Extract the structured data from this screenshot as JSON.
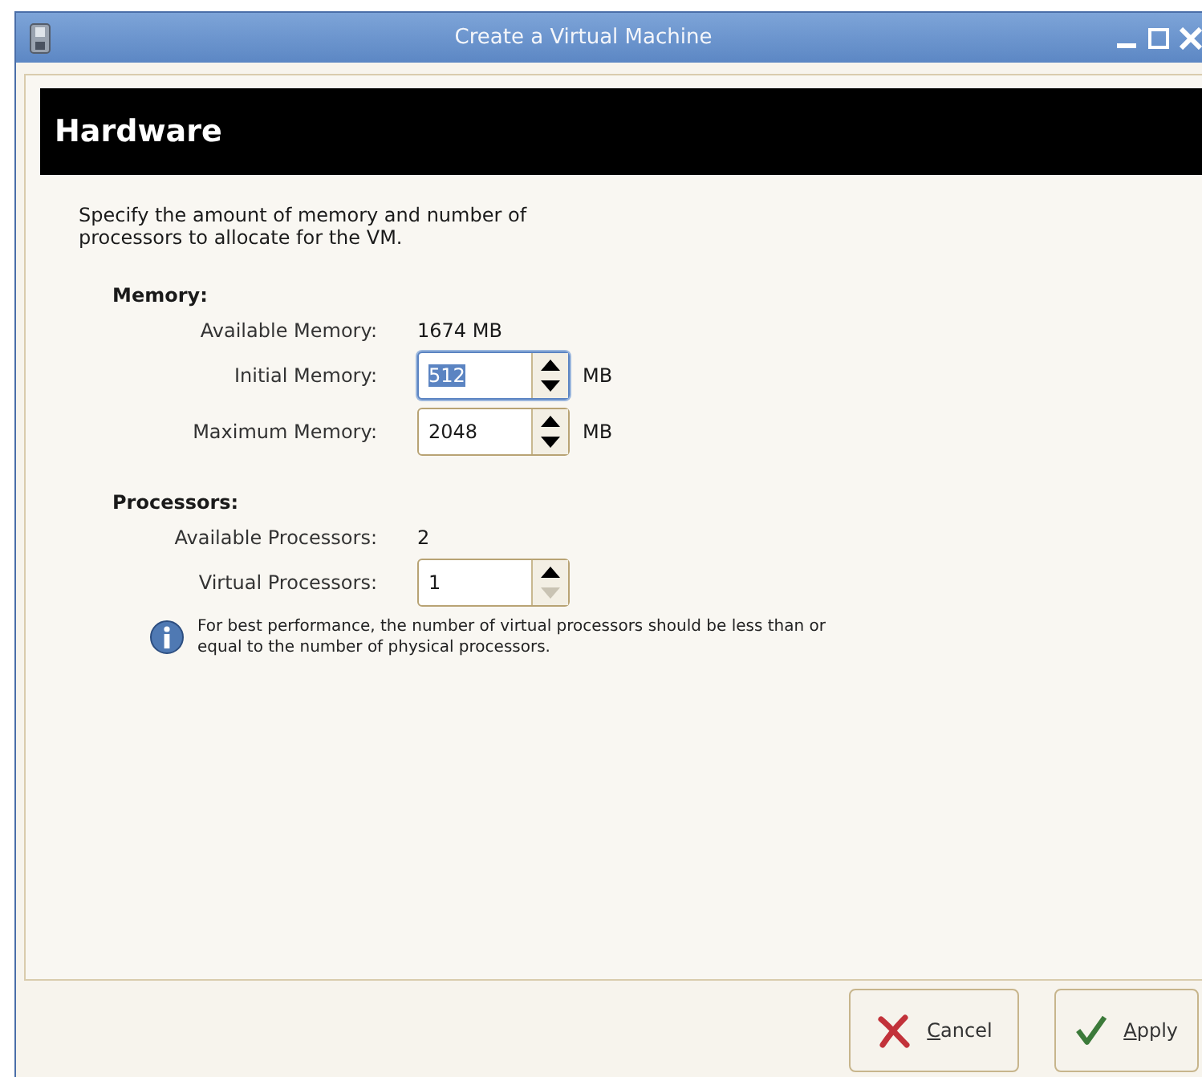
{
  "window": {
    "title": "Create a Virtual Machine"
  },
  "page_title": "Hardware",
  "description": "Specify the amount of memory and number of processors to allocate for the VM.",
  "sections": [
    {
      "heading": "Memory:",
      "rows": [
        {
          "kind": "value",
          "label": "Available Memory:",
          "value": "1674 MB"
        },
        {
          "kind": "spin",
          "label": "Initial Memory:",
          "value": "512",
          "unit": "MB",
          "focused": true,
          "decrement_disabled": false
        },
        {
          "kind": "spin",
          "label": "Maximum Memory:",
          "value": "2048",
          "unit": "MB",
          "focused": false,
          "decrement_disabled": false
        }
      ]
    },
    {
      "heading": "Processors:",
      "rows": [
        {
          "kind": "value",
          "label": "Available Processors:",
          "value": "2"
        },
        {
          "kind": "spin",
          "label": "Virtual Processors:",
          "value": "1",
          "focused": false,
          "decrement_disabled": true
        }
      ]
    }
  ],
  "info_note": "For best performance, the number of virtual processors should be less than or equal to the number of physical processors.",
  "buttons": [
    {
      "kind": "cancel",
      "mnemonic": "C",
      "rest": "ancel"
    },
    {
      "kind": "apply",
      "mnemonic": "A",
      "rest": "pply"
    }
  ]
}
